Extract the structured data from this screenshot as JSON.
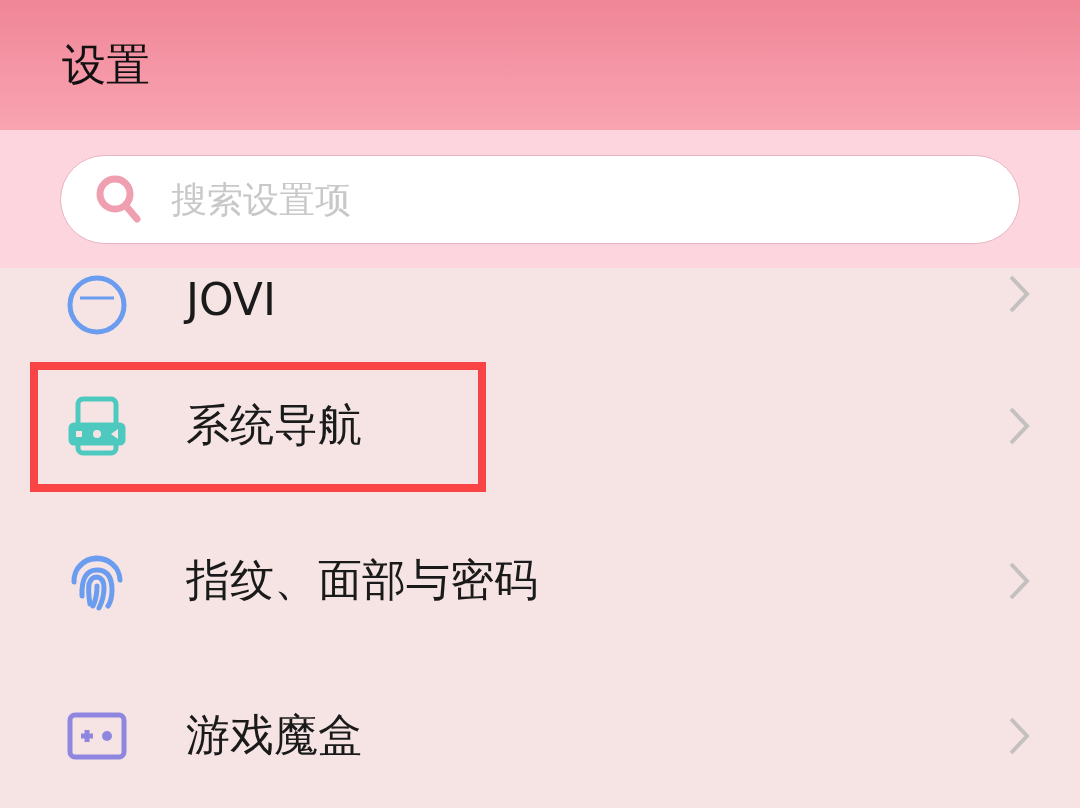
{
  "header": {
    "title": "设置"
  },
  "search": {
    "placeholder": "搜索设置项"
  },
  "items": [
    {
      "kind": "jovi",
      "label": "JOVI",
      "highlighted": false
    },
    {
      "kind": "navigation",
      "label": "系统导航",
      "highlighted": true
    },
    {
      "kind": "fingerprint",
      "label": "指纹、面部与密码",
      "highlighted": false
    },
    {
      "kind": "gamebox",
      "label": "游戏魔盒",
      "highlighted": false
    }
  ]
}
